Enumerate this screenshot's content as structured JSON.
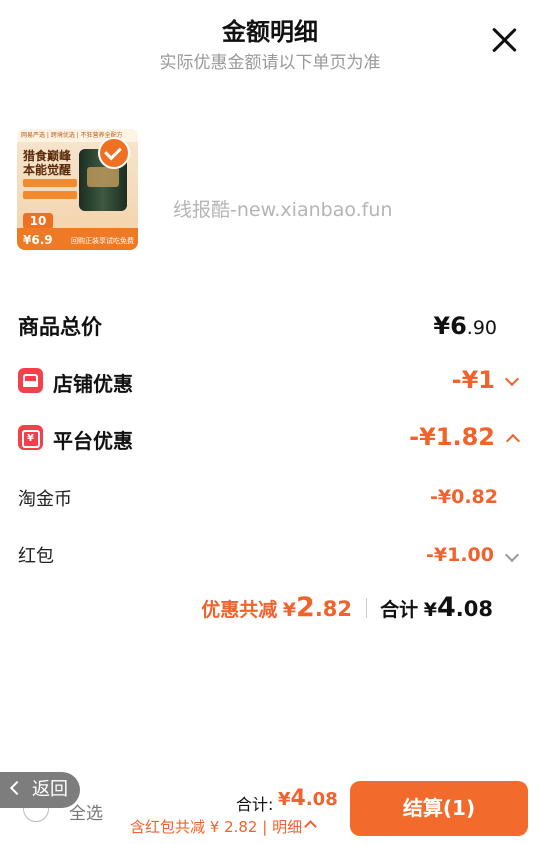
{
  "header": {
    "title": "金额明细",
    "subtitle": "实际优惠金额请以下单页为准"
  },
  "product": {
    "top_text": "网易严选 | 跨境优选 | 不狂营养全配方",
    "headline_line1": "猎食巅峰",
    "headline_line2": "本能觉醒",
    "promo_badge": "10",
    "price": "¥6.9",
    "footer_text": "回购正装享试吃免费"
  },
  "watermark": "线报酷-new.xianbao.fun",
  "rows": {
    "total_label": "商品总价",
    "total_symbol": "¥",
    "total_int": "6",
    "total_dec": ".90",
    "shop_label": "店铺优惠",
    "shop_value": "-¥1",
    "platform_label": "平台优惠",
    "platform_value": "-¥1.82",
    "coins_label": "淘金币",
    "coins_value": "-¥0.82",
    "redpacket_label": "红包",
    "redpacket_value": "-¥1.00"
  },
  "summary": {
    "discount_label": "优惠共减",
    "discount_symbol": "¥",
    "discount_int": "2",
    "discount_dec": ".82",
    "total_label": "合计",
    "total_symbol": "¥",
    "total_int": "4",
    "total_dec": ".08"
  },
  "bottom": {
    "back_label": "返回",
    "select_all": "全选",
    "total_label": "合计:",
    "total_symbol": "¥",
    "total_int": "4",
    "total_dec": ".08",
    "note": "含红包共减 ¥ 2.82 | 明细",
    "checkout_label": "结算(1)"
  },
  "colors": {
    "accent": "#f0632c",
    "icon_red": "#f2414b",
    "checkout_bg": "#f26b2d"
  },
  "icons": [
    "close-icon",
    "store-icon",
    "yen-coupon-icon",
    "chevron-down-icon",
    "chevron-up-icon",
    "chevron-left-icon",
    "radio-circle-icon"
  ]
}
